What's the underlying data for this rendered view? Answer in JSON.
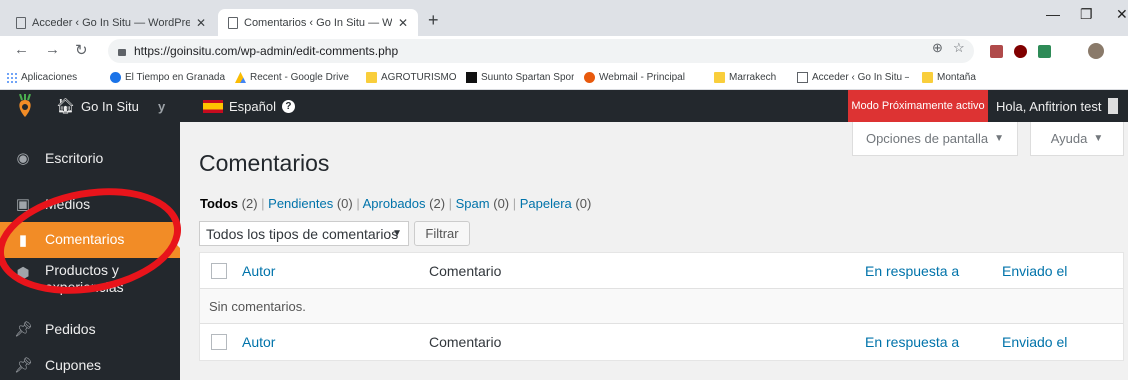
{
  "browser": {
    "tabs": [
      {
        "title": "Acceder ‹ Go In Situ — WordPress"
      },
      {
        "title": "Comentarios ‹ Go In Situ — WordPress"
      }
    ],
    "url": "https://goinsitu.com/wp-admin/edit-comments.php",
    "bookmarks": [
      {
        "label": "Aplicaciones",
        "icon": "apps-grid-icon"
      },
      {
        "label": "El Tiempo en Granada",
        "icon": "weather-icon"
      },
      {
        "label": "Recent - Google Drive",
        "icon": "drive-icon"
      },
      {
        "label": "AGROTURISMO",
        "icon": "folder-icon"
      },
      {
        "label": "Suunto Spartan Sport",
        "icon": "suunto-icon"
      },
      {
        "label": "Webmail - Principal",
        "icon": "webmail-icon"
      },
      {
        "label": "Marrakech",
        "icon": "folder-icon"
      },
      {
        "label": "Acceder ‹ Go In Situ —",
        "icon": "page-icon"
      },
      {
        "label": "Montaña",
        "icon": "folder-icon"
      }
    ]
  },
  "adminbar": {
    "site_name": "Go In Situ",
    "language": "Español",
    "modo": "Modo Próximamente activo",
    "greeting": "Hola, Anfitrion test"
  },
  "sidebar": {
    "items": [
      {
        "label": "Escritorio",
        "icon": "dashboard-icon"
      },
      {
        "label": "Medios",
        "icon": "media-icon"
      },
      {
        "label": "Comentarios",
        "icon": "comment-icon",
        "active": true
      },
      {
        "label": "Productos y experiencias",
        "icon": "product-icon"
      },
      {
        "label": "Pedidos",
        "icon": "pin-icon"
      },
      {
        "label": "Cupones",
        "icon": "pin-icon"
      }
    ]
  },
  "screen_meta": {
    "options": "Opciones de pantalla",
    "help": "Ayuda"
  },
  "main": {
    "title": "Comentarios",
    "filters": [
      {
        "label": "Todos",
        "count": "(2)"
      },
      {
        "label": "Pendientes",
        "count": "(0)"
      },
      {
        "label": "Aprobados",
        "count": "(2)"
      },
      {
        "label": "Spam",
        "count": "(0)"
      },
      {
        "label": "Papelera",
        "count": "(0)"
      }
    ],
    "select_value": "Todos los tipos de comentarios",
    "filter_button": "Filtrar",
    "columns": {
      "author": "Autor",
      "comment": "Comentario",
      "response": "En respuesta a",
      "date": "Enviado el"
    },
    "empty": "Sin comentarios."
  },
  "colors": {
    "adminbar": "#23282d",
    "active_menu": "#f28c26",
    "link": "#0073aa",
    "modo": "#dd3333",
    "annotation": "#e8141b"
  }
}
